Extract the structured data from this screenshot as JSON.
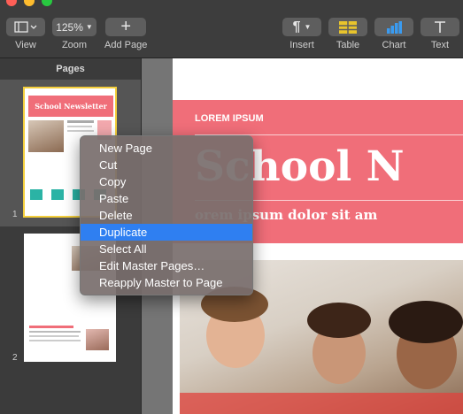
{
  "toolbar": {
    "view_label": "View",
    "zoom_value": "125%",
    "zoom_label": "Zoom",
    "add_page_label": "Add Page",
    "insert_label": "Insert",
    "table_label": "Table",
    "chart_label": "Chart",
    "text_label": "Text"
  },
  "sidebar": {
    "title": "Pages",
    "pages": [
      {
        "number": "1",
        "thumb_title": "School Newsletter"
      },
      {
        "number": "2"
      }
    ]
  },
  "document": {
    "banner_kicker": "LOREM IPSUM",
    "banner_title": "School N",
    "banner_subtitle": "orem ipsum dolor sit am"
  },
  "context_menu": {
    "items": [
      "New Page",
      "Cut",
      "Copy",
      "Paste",
      "Delete",
      "Duplicate",
      "Select All",
      "Edit Master Pages…",
      "Reapply Master to Page"
    ],
    "selected": "Duplicate"
  },
  "colors": {
    "accent": "#2f7ff1",
    "banner": "#f06e79",
    "thumb_selection": "#f4cf3c"
  }
}
